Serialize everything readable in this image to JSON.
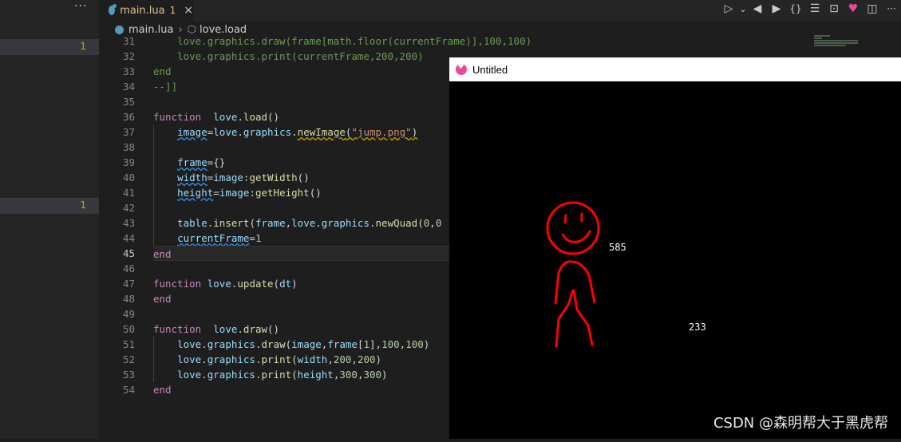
{
  "sidebar": {
    "more_label": "···",
    "problem_counts": [
      "1",
      "1"
    ]
  },
  "tabs": [
    {
      "label": "main.lua",
      "problems": "1",
      "close": "×"
    }
  ],
  "toolbar": {
    "icons": [
      "run-icon",
      "chevron-down-icon",
      "prev-icon",
      "next-icon",
      "braces-icon",
      "list-icon",
      "terminal-icon",
      "love-icon",
      "split-editor-icon",
      "more-icon"
    ],
    "glyphs": [
      "▷",
      "⌄",
      "◀",
      "▶",
      "{}",
      "☰",
      "⊡",
      "♥",
      "◫",
      "···"
    ]
  },
  "breadcrumb": {
    "file": "main.lua",
    "symbol": "love.load"
  },
  "editor": {
    "line_numbers": [
      "31",
      "32",
      "33",
      "34",
      "35",
      "36",
      "37",
      "38",
      "39",
      "40",
      "41",
      "42",
      "43",
      "44",
      "45",
      "46",
      "47",
      "48",
      "49",
      "50",
      "51",
      "52",
      "53",
      "54"
    ],
    "active_line": "45"
  },
  "love_window": {
    "title": "Untitled",
    "outputs": [
      "585",
      "233"
    ]
  },
  "watermark": "CSDN @森明帮大于黑虎帮",
  "colors": {
    "editor_bg": "#1e1e1e",
    "keyword": "#c586c0",
    "function": "#dcdcaa",
    "string": "#ce9178",
    "number": "#b5cea8",
    "variable": "#9cdcfe",
    "stickman": "#ff0000"
  }
}
